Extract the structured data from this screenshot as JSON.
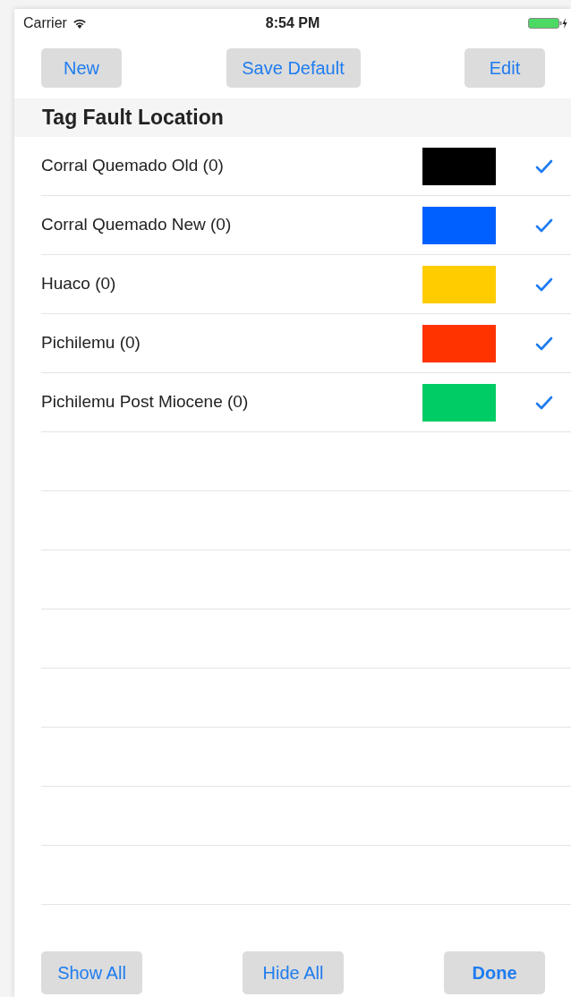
{
  "status_bar": {
    "carrier": "Carrier",
    "time": "8:54 PM"
  },
  "top_buttons": [
    {
      "label": "New"
    },
    {
      "label": "Save Default"
    },
    {
      "label": "Edit"
    }
  ],
  "section_title": "Tag Fault Location",
  "rows": [
    {
      "label": "Corral Quemado Old (0)",
      "color": "#000000",
      "checked": true
    },
    {
      "label": "Corral Quemado New (0)",
      "color": "#0060ff",
      "checked": true
    },
    {
      "label": "Huaco (0)",
      "color": "#ffcc00",
      "checked": true
    },
    {
      "label": "Pichilemu (0)",
      "color": "#ff3300",
      "checked": true
    },
    {
      "label": "Pichilemu Post Miocene (0)",
      "color": "#00cc66",
      "checked": true
    }
  ],
  "bottom_buttons": [
    {
      "label": "Show All",
      "bold": false
    },
    {
      "label": "Hide All",
      "bold": false
    },
    {
      "label": "Done",
      "bold": true
    }
  ]
}
